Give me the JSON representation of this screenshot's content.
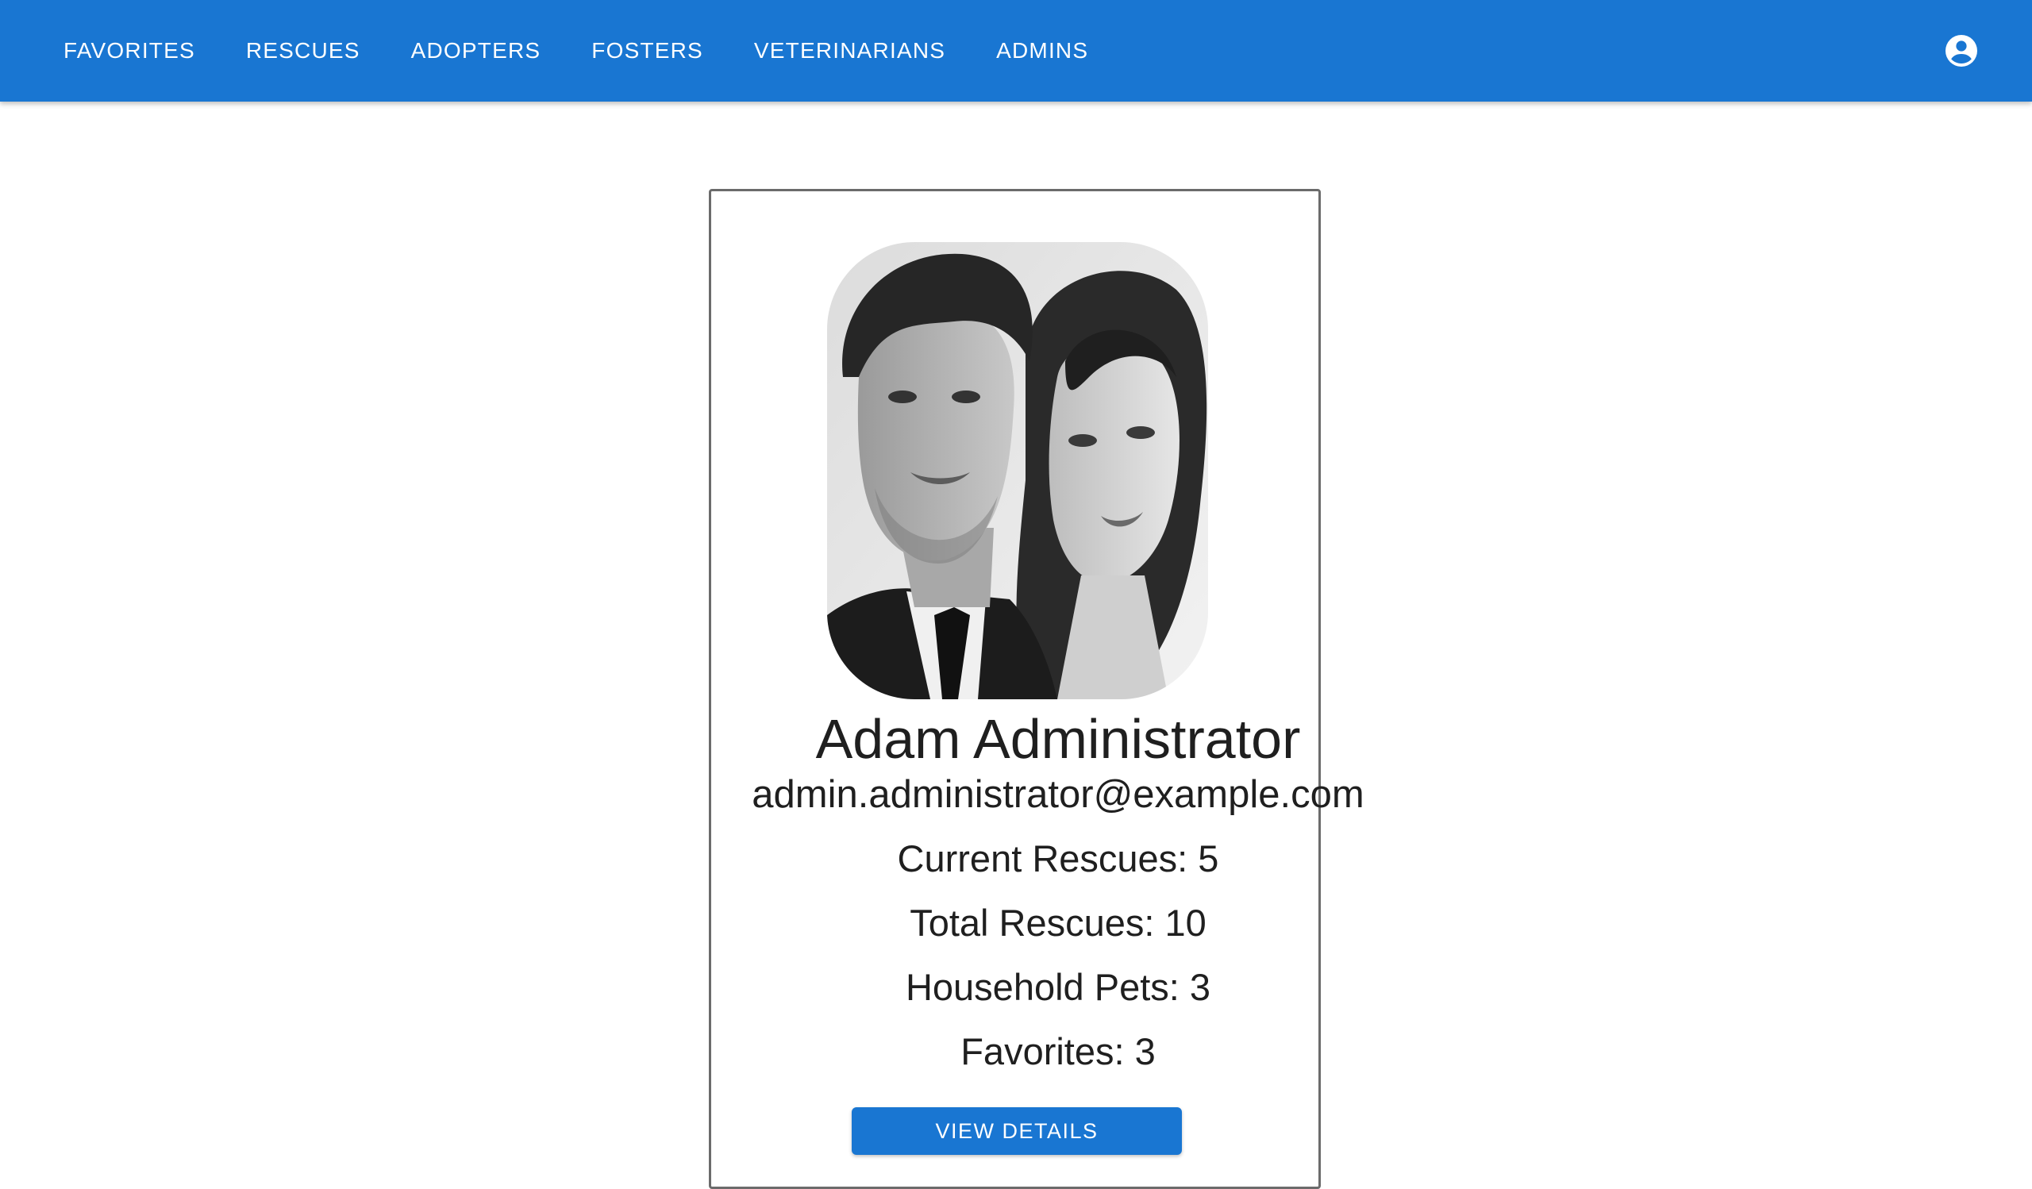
{
  "nav": {
    "items": [
      {
        "label": "FAVORITES"
      },
      {
        "label": "RESCUES"
      },
      {
        "label": "ADOPTERS"
      },
      {
        "label": "FOSTERS"
      },
      {
        "label": "VETERINARIANS"
      },
      {
        "label": "ADMINS"
      }
    ],
    "account_icon": "account-circle-icon"
  },
  "profile": {
    "name": "Adam Administrator",
    "email": "admin.administrator@example.com",
    "stats": {
      "current_rescues": "Current Rescues: 5",
      "total_rescues": "Total Rescues: 10",
      "household_pets": "Household Pets: 3",
      "favorites": "Favorites: 3"
    },
    "view_details_label": "VIEW DETAILS"
  },
  "colors": {
    "app_bar": "#1976d2",
    "button": "#1976d2",
    "card_border": "#6b6b6b"
  }
}
